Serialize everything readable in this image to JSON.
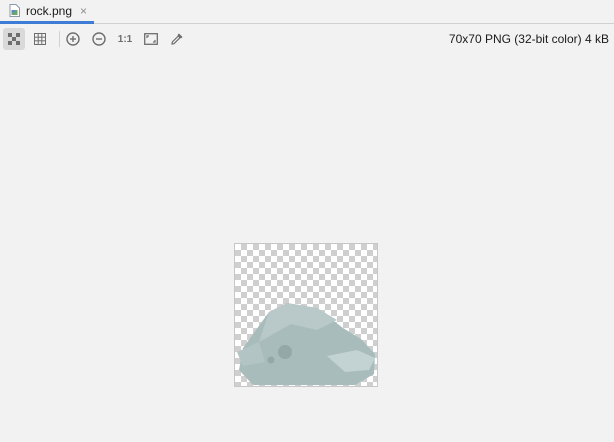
{
  "tab": {
    "filename": "rock.png",
    "close_glyph": "×",
    "icon": "png-file-icon"
  },
  "toolbar": {
    "tools": [
      {
        "name": "transparency-chessboard",
        "icon": "chessboard-icon",
        "active": true
      },
      {
        "name": "grid",
        "icon": "grid-icon",
        "active": false
      },
      {
        "name": "zoom-in",
        "icon": "zoom-in-icon",
        "active": false
      },
      {
        "name": "zoom-out",
        "icon": "zoom-out-icon",
        "active": false
      },
      {
        "name": "actual-size",
        "icon": "actual-size-icon",
        "label": "1:1",
        "active": false
      },
      {
        "name": "fit-zoom",
        "icon": "fit-to-window-icon",
        "active": false
      },
      {
        "name": "color-picker",
        "icon": "eyedropper-icon",
        "active": false
      }
    ],
    "image_info": "70x70 PNG (32-bit color) 4 kB"
  },
  "colors": {
    "accent": "#3d7dd6",
    "background": "#f2f2f2",
    "rock_light": "#b9c9c9",
    "rock_mid": "#a9bcbc",
    "rock_dark": "#94a8a8"
  }
}
